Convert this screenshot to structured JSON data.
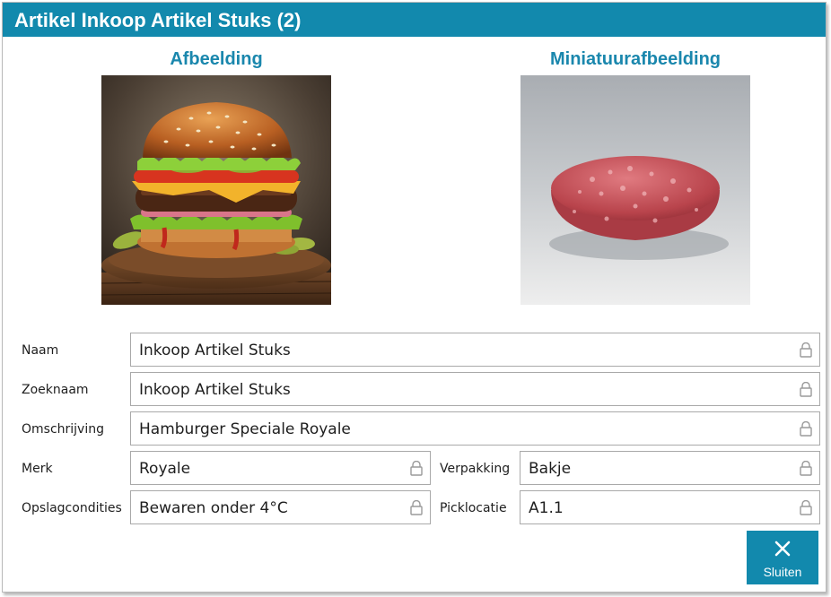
{
  "window": {
    "title": "Artikel Inkoop Artikel Stuks (2)"
  },
  "images": {
    "main_heading": "Afbeelding",
    "thumb_heading": "Miniatuurafbeelding",
    "main_image": "hamburger-image",
    "thumb_image": "burger-patty-image"
  },
  "fields": {
    "naam": {
      "label": "Naam",
      "value": "Inkoop Artikel Stuks"
    },
    "zoeknaam": {
      "label": "Zoeknaam",
      "value": "Inkoop Artikel Stuks"
    },
    "omschrijving": {
      "label": "Omschrijving",
      "value": "Hamburger Speciale Royale"
    },
    "merk": {
      "label": "Merk",
      "value": "Royale"
    },
    "verpakking": {
      "label": "Verpakking",
      "value": "Bakje"
    },
    "opslagcondities": {
      "label": "Opslagcondities",
      "value": "Bewaren onder 4°C"
    },
    "picklocatie": {
      "label": "Picklocatie",
      "value": "A1.1"
    }
  },
  "actions": {
    "close_label": "Sluiten"
  },
  "icons": {
    "lock": "lock-icon",
    "close": "close-icon"
  },
  "colors": {
    "accent": "#1289ad",
    "heading": "#1a87ad",
    "field_border": "#a9a9a9",
    "lock": "#9a9a9a"
  }
}
